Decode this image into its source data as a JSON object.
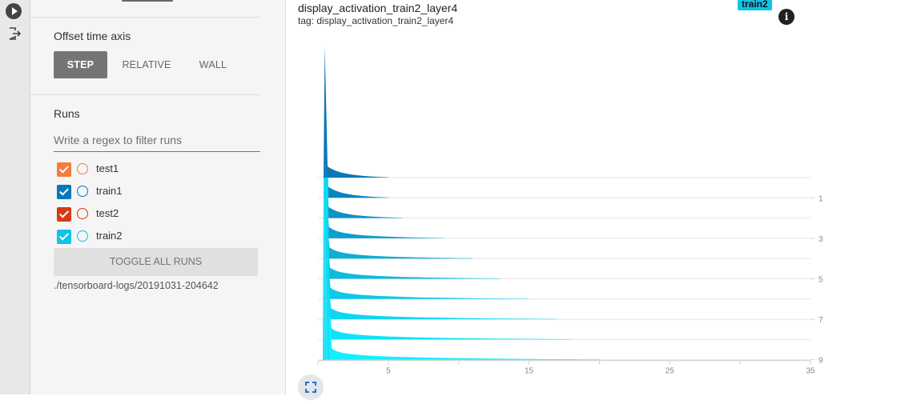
{
  "rail": {
    "icons": [
      "play-icon",
      "exit-icon"
    ]
  },
  "sidebar": {
    "offset_label": "Offset time axis",
    "offset_options": [
      "STEP",
      "RELATIVE",
      "WALL"
    ],
    "offset_selected": "STEP",
    "runs_label": "Runs",
    "filter": {
      "placeholder": "Write a regex to filter runs",
      "value": ""
    },
    "runs": [
      {
        "name": "test1",
        "color": "#f57c3c",
        "checked": true
      },
      {
        "name": "train1",
        "color": "#0a77b6",
        "checked": true
      },
      {
        "name": "test2",
        "color": "#d63a15",
        "checked": true
      },
      {
        "name": "train2",
        "color": "#11c3e6",
        "checked": true
      }
    ],
    "toggle_all_label": "TOGGLE ALL RUNS",
    "logdir": "./tensorboard-logs/20191031-204642"
  },
  "card": {
    "title": "display_activation_train2_layer4",
    "tag": "tag: display_activation_train2_layer4",
    "run_chip": "train2",
    "run_chip_color": "#11c3e6",
    "info_icon": "info-icon",
    "expand_icon": "expand-icon"
  },
  "chart_data": {
    "type": "area",
    "mode": "offset histogram",
    "title": "",
    "x_ticks": [
      "5",
      "15",
      "25",
      "35"
    ],
    "y_ticks": [
      "1",
      "3",
      "5",
      "7",
      "9"
    ],
    "xlim": [
      0,
      35
    ],
    "steps": [
      0,
      1,
      2,
      3,
      4,
      5,
      6,
      7,
      8,
      9
    ],
    "series": [
      {
        "step": 0,
        "peak": 100,
        "tail_end": 5
      },
      {
        "step": 1,
        "peak": 28,
        "tail_end": 5
      },
      {
        "step": 2,
        "peak": 25,
        "tail_end": 6
      },
      {
        "step": 3,
        "peak": 22,
        "tail_end": 9
      },
      {
        "step": 4,
        "peak": 20,
        "tail_end": 11
      },
      {
        "step": 5,
        "peak": 19,
        "tail_end": 13
      },
      {
        "step": 6,
        "peak": 18,
        "tail_end": 15
      },
      {
        "step": 7,
        "peak": 17,
        "tail_end": 17
      },
      {
        "step": 8,
        "peak": 16,
        "tail_end": 18
      },
      {
        "step": 9,
        "peak": 15,
        "tail_end": 20
      }
    ],
    "color_range": [
      "#0a77b6",
      "#11f0ff"
    ]
  }
}
